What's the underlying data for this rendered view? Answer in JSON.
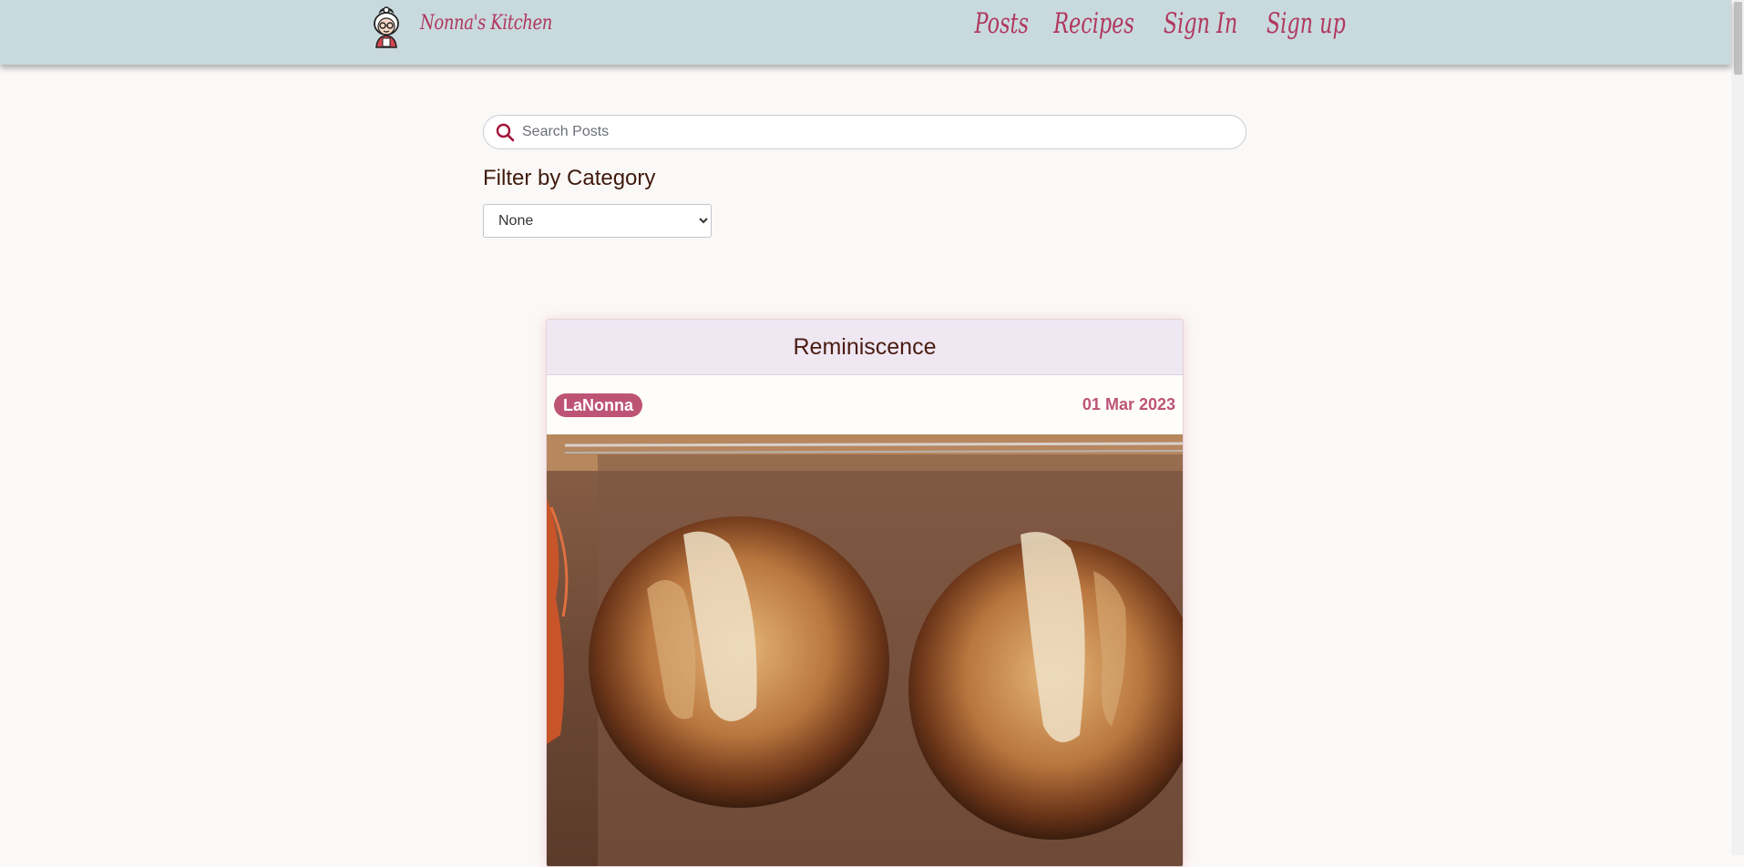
{
  "navbar": {
    "brand_name": "Nonna's Kitchen",
    "links": [
      "Posts",
      "Recipes",
      "Sign In",
      "Sign up"
    ]
  },
  "search": {
    "placeholder": "Search Posts",
    "value": ""
  },
  "filter": {
    "title": "Filter by Category",
    "selected": "None"
  },
  "post": {
    "title": "Reminiscence",
    "author": "LaNonna",
    "date": "01 Mar 2023"
  },
  "colors": {
    "navbar_bg": "#c9dadf",
    "accent": "#b0375d",
    "badge": "#bd5476",
    "page_bg": "#fbf9f7",
    "text_dark": "#3f1a0c"
  },
  "icons": {
    "brand": "grandma-avatar-icon",
    "search": "search-icon"
  }
}
